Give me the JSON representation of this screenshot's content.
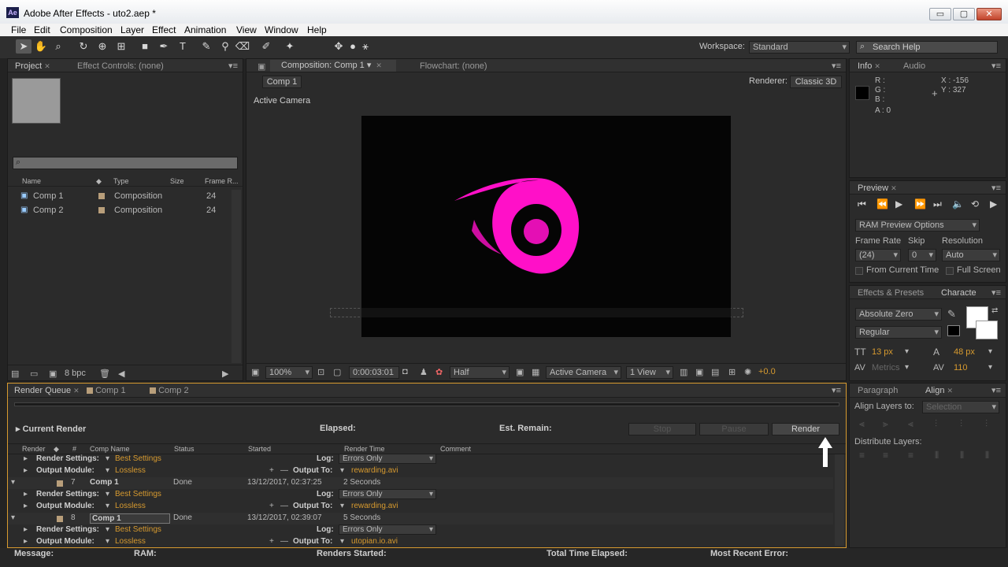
{
  "window": {
    "title": "Adobe After Effects - uto2.aep *",
    "app_icon": "Ae",
    "minimize": "▭",
    "maximize": "▢",
    "close": "✕"
  },
  "menu": [
    "File",
    "Edit",
    "Composition",
    "Layer",
    "Effect",
    "Animation",
    "View",
    "Window",
    "Help"
  ],
  "toolbar": {
    "workspace_label": "Workspace:",
    "workspace_value": "Standard",
    "search_placeholder": "Search Help"
  },
  "project": {
    "tab": "Project",
    "effect_controls_tab": "Effect Controls: (none)",
    "columns": [
      "Name",
      "Type",
      "Size",
      "Frame R..."
    ],
    "items": [
      {
        "name": "Comp 1",
        "type": "Composition",
        "frame_rate": "24"
      },
      {
        "name": "Comp 2",
        "type": "Composition",
        "frame_rate": "24"
      }
    ],
    "bpc": "8 bpc"
  },
  "composition": {
    "tab": "Composition: Comp 1",
    "flowchart_tab": "Flowchart: (none)",
    "comp_button": "Comp 1",
    "renderer_label": "Renderer:",
    "renderer_value": "Classic 3D",
    "camera_label": "Active Camera",
    "zoom": "100%",
    "timecode": "0:00:03:01",
    "resolution": "Half",
    "view_camera": "Active Camera",
    "views": "1 View",
    "exposure": "+0.0"
  },
  "info": {
    "tab": "Info",
    "audio_tab": "Audio",
    "r": "R :",
    "g": "G :",
    "b": "B :",
    "a": "A : 0",
    "x": "X : -156",
    "y": "Y : 327"
  },
  "preview": {
    "tab": "Preview",
    "ram_options": "RAM Preview Options",
    "frame_rate_label": "Frame Rate",
    "skip_label": "Skip",
    "resolution_label": "Resolution",
    "frame_rate_value": "(24)",
    "skip_value": "0",
    "resolution_value": "Auto",
    "from_current": "From Current Time",
    "full_screen": "Full Screen"
  },
  "character": {
    "effects_tab": "Effects & Presets",
    "character_tab": "Characte",
    "font": "Absolute Zero",
    "style": "Regular",
    "size": "13 px",
    "leading": "48 px",
    "kerning": "Metrics",
    "tracking": "110"
  },
  "align": {
    "paragraph_tab": "Paragraph",
    "align_tab": "Align",
    "align_to_label": "Align Layers to:",
    "align_to_value": "Selection",
    "distribute_label": "Distribute Layers:"
  },
  "render_queue": {
    "tab": "Render Queue",
    "tab2": "Comp 1",
    "tab3": "Comp 2",
    "current_render": "Current Render",
    "elapsed": "Elapsed:",
    "est_remain": "Est. Remain:",
    "stop": "Stop",
    "pause": "Pause",
    "render": "Render",
    "columns": [
      "Render",
      "#",
      "Comp Name",
      "Status",
      "Started",
      "Render Time",
      "Comment"
    ],
    "rows": [
      {
        "kind": "settings",
        "label": "Render Settings:",
        "value": "Best Settings",
        "right_label": "Log:",
        "right_value": "Errors Only"
      },
      {
        "kind": "output",
        "label": "Output Module:",
        "value": "Lossless",
        "right_label": "Output To:",
        "right_value": "rewarding.avi"
      },
      {
        "kind": "item",
        "num": "7",
        "comp": "Comp 1",
        "status": "Done",
        "started": "13/12/2017, 02:37:25",
        "time": "2 Seconds"
      },
      {
        "kind": "settings",
        "label": "Render Settings:",
        "value": "Best Settings",
        "right_label": "Log:",
        "right_value": "Errors Only"
      },
      {
        "kind": "output",
        "label": "Output Module:",
        "value": "Lossless",
        "right_label": "Output To:",
        "right_value": "rewarding.avi"
      },
      {
        "kind": "item",
        "num": "8",
        "comp": "Comp 1",
        "status": "Done",
        "started": "13/12/2017, 02:39:07",
        "time": "5 Seconds"
      },
      {
        "kind": "settings",
        "label": "Render Settings:",
        "value": "Best Settings",
        "right_label": "Log:",
        "right_value": "Errors Only"
      },
      {
        "kind": "output",
        "label": "Output Module:",
        "value": "Lossless",
        "right_label": "Output To:",
        "right_value": "utopian.io.avi"
      }
    ]
  },
  "statusbar": {
    "message": "Message:",
    "ram": "RAM:",
    "renders_started": "Renders Started:",
    "total_time": "Total Time Elapsed:",
    "recent_error": "Most Recent Error:"
  },
  "colors": {
    "accent": "#d79a2f",
    "logo": "#ff10c8"
  }
}
